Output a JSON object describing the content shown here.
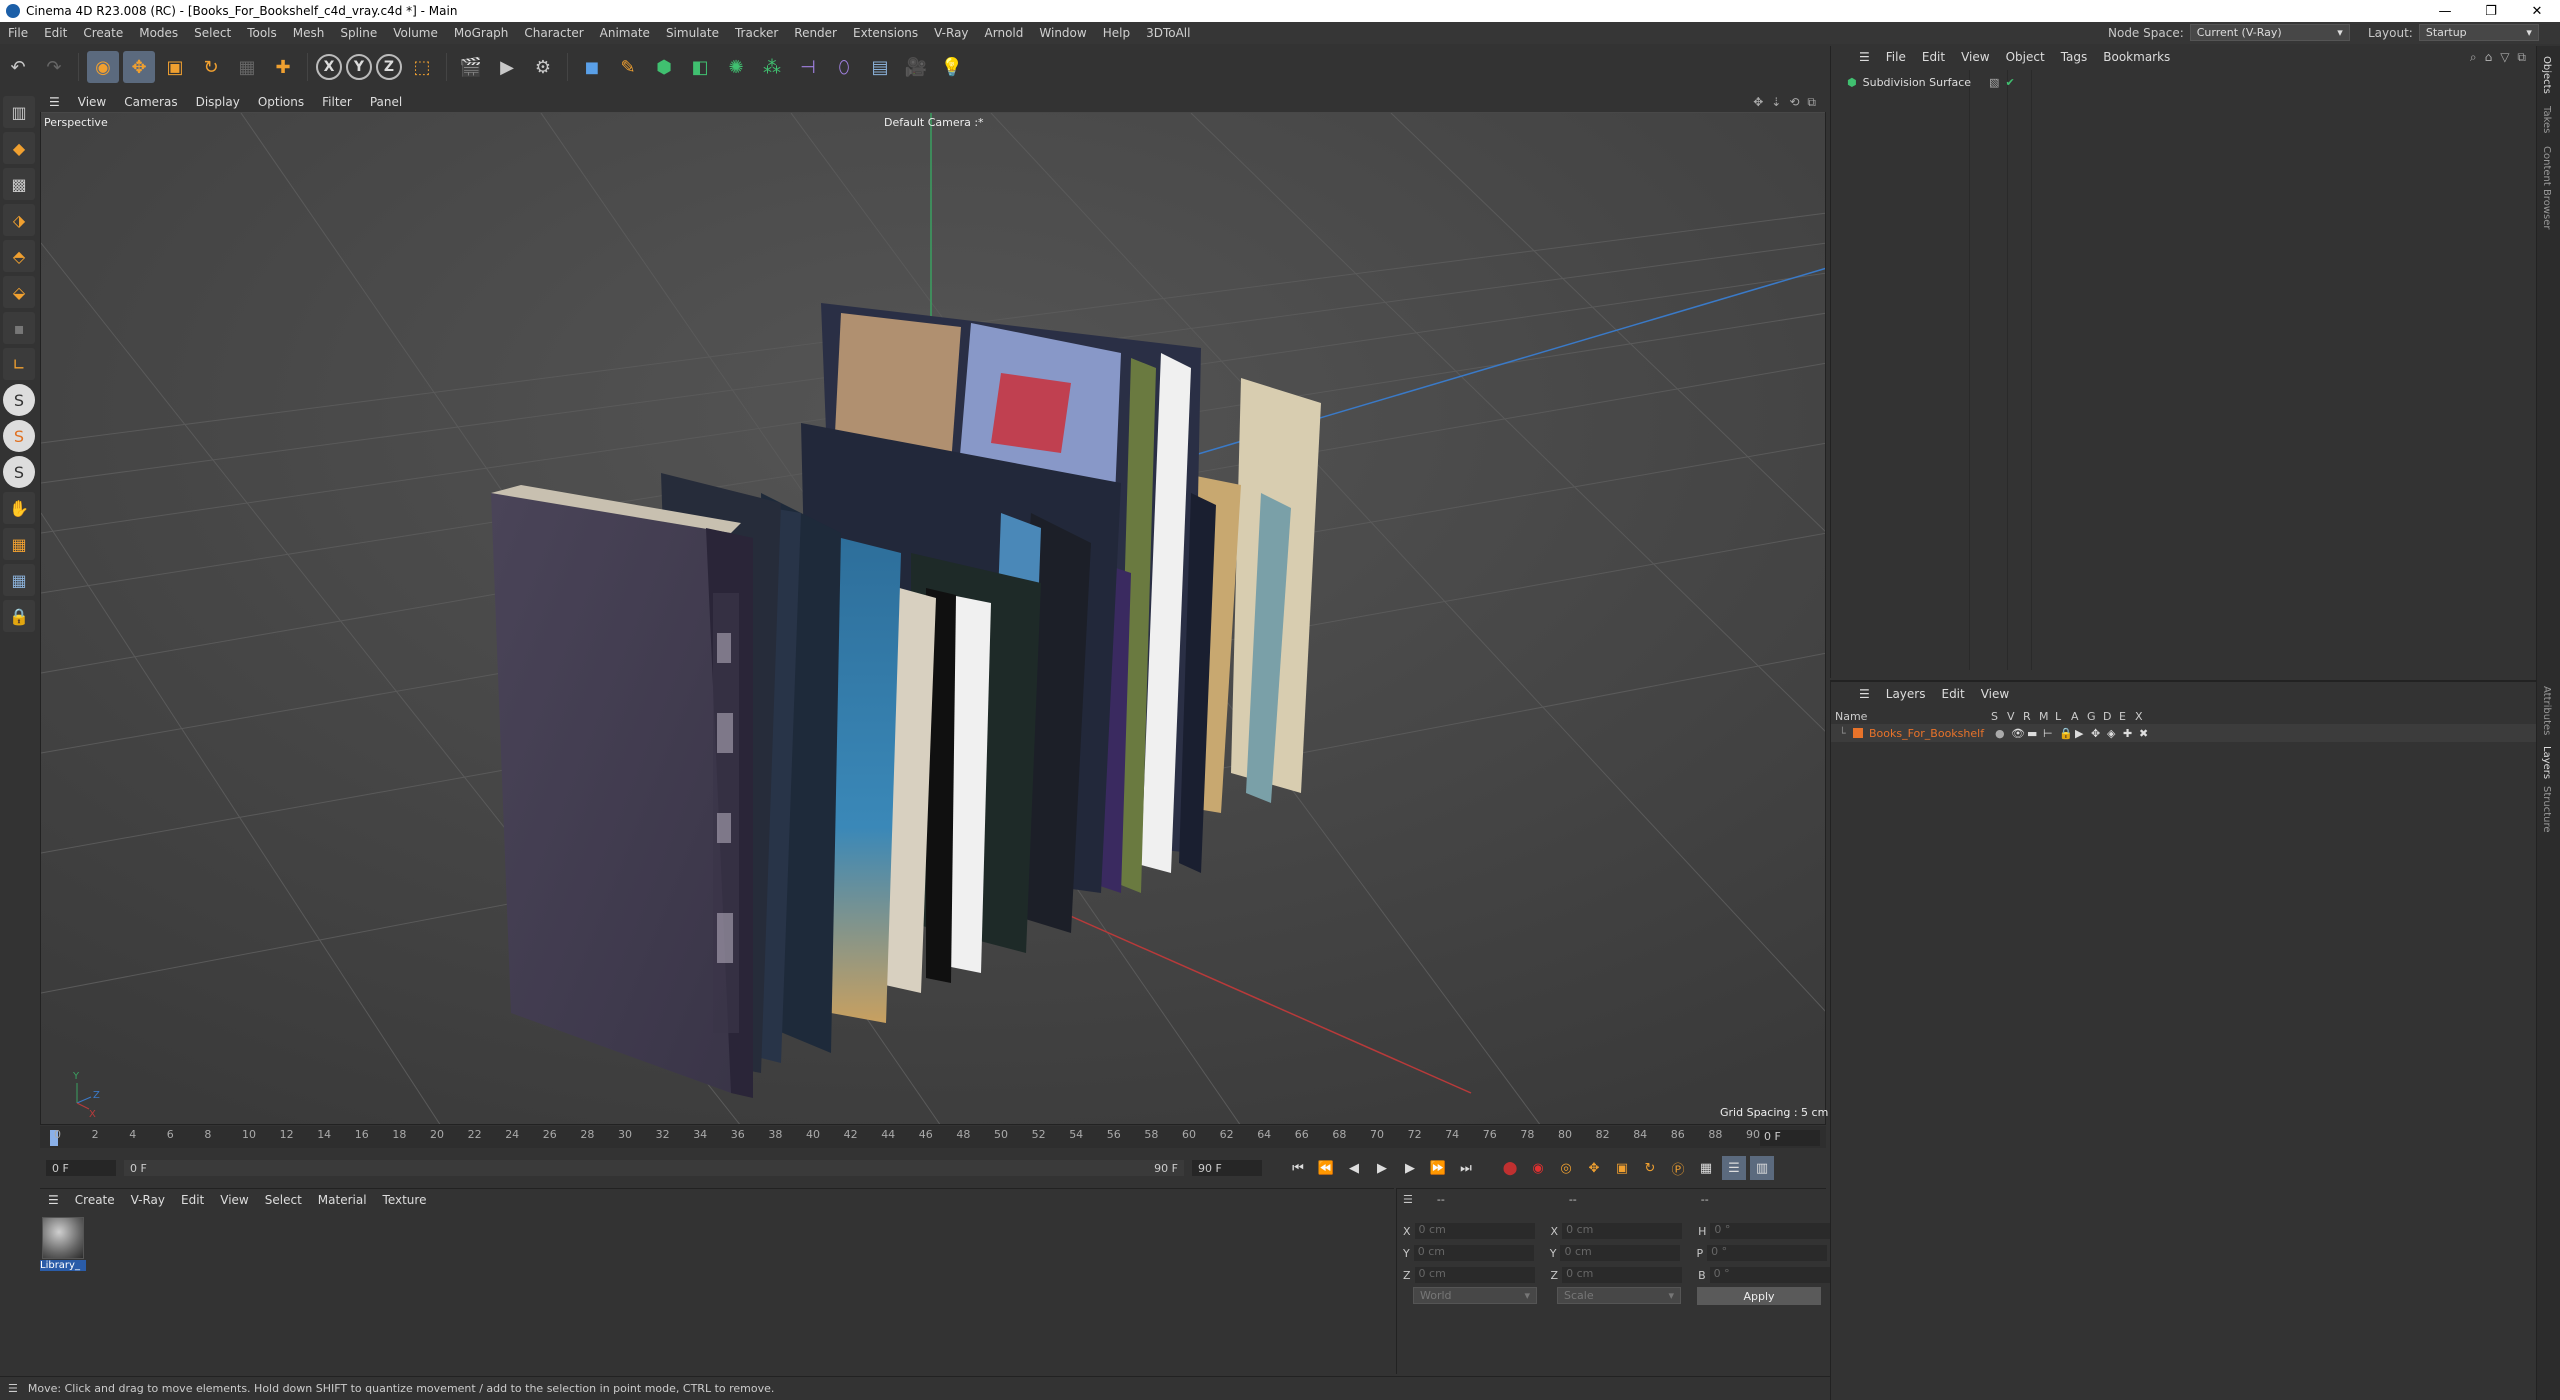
{
  "window": {
    "title": "Cinema 4D R23.008 (RC) - [Books_For_Bookshelf_c4d_vray.c4d *] - Main",
    "controls": [
      "—",
      "❐",
      "✕"
    ]
  },
  "menubar": {
    "items": [
      "File",
      "Edit",
      "Create",
      "Modes",
      "Select",
      "Tools",
      "Mesh",
      "Spline",
      "Volume",
      "MoGraph",
      "Character",
      "Animate",
      "Simulate",
      "Tracker",
      "Render",
      "Extensions",
      "V-Ray",
      "Arnold",
      "Window",
      "Help",
      "3DToAll"
    ],
    "node_space_label": "Node Space:",
    "node_space_value": "Current (V-Ray)",
    "layout_label": "Layout:",
    "layout_value": "Startup"
  },
  "toolbar": {
    "icons": [
      "undo-icon",
      "redo-icon",
      "live-selection-icon",
      "move-icon",
      "scale-icon",
      "rotate-icon",
      "recent-tools-icon",
      "add-icon",
      "x-axis-icon",
      "y-axis-icon",
      "z-axis-icon",
      "coordinate-system-icon",
      "render-region-icon",
      "render-view-icon",
      "render-settings-icon",
      "cube-icon",
      "pen-icon",
      "subdivision-icon",
      "extrude-icon",
      "cloner-icon",
      "array-icon",
      "symmetry-icon",
      "deformer-icon",
      "floor-icon",
      "camera-icon",
      "light-icon"
    ],
    "axis_labels": [
      "X",
      "Y",
      "Z"
    ]
  },
  "viewport": {
    "menu": [
      "View",
      "Cameras",
      "Display",
      "Options",
      "Filter",
      "Panel"
    ],
    "view_name": "Perspective",
    "camera_name": "Default Camera :*",
    "grid_spacing": "Grid Spacing : 5 cm",
    "axis_letters": [
      "Y",
      "Z",
      "X"
    ]
  },
  "timeline": {
    "ticks": [
      "0",
      "2",
      "4",
      "6",
      "8",
      "10",
      "12",
      "14",
      "16",
      "18",
      "20",
      "22",
      "24",
      "26",
      "28",
      "30",
      "32",
      "34",
      "36",
      "38",
      "40",
      "42",
      "44",
      "46",
      "48",
      "50",
      "52",
      "54",
      "56",
      "58",
      "60",
      "62",
      "64",
      "66",
      "68",
      "70",
      "72",
      "74",
      "76",
      "78",
      "80",
      "82",
      "84",
      "86",
      "88",
      "90"
    ],
    "current_frame_box": "0 F",
    "start_frame": "0 F",
    "range_start": "0 F",
    "range_end": "90 F",
    "end_frame": "90 F"
  },
  "materials": {
    "menu": [
      "Create",
      "V-Ray",
      "Edit",
      "View",
      "Select",
      "Material",
      "Texture"
    ],
    "items": [
      {
        "name": "Library_"
      }
    ]
  },
  "coordinates": {
    "header": [
      "--",
      "--",
      "--"
    ],
    "rows": [
      {
        "a": "X",
        "a_val": "0 cm",
        "b": "X",
        "b_val": "0 cm",
        "c": "H",
        "c_val": "0 °"
      },
      {
        "a": "Y",
        "a_val": "0 cm",
        "b": "Y",
        "b_val": "0 cm",
        "c": "P",
        "c_val": "0 °"
      },
      {
        "a": "Z",
        "a_val": "0 cm",
        "b": "Z",
        "b_val": "0 cm",
        "c": "B",
        "c_val": "0 °"
      }
    ],
    "space": "World",
    "mode": "Scale",
    "apply": "Apply"
  },
  "objects": {
    "menu": [
      "File",
      "Edit",
      "View",
      "Object",
      "Tags",
      "Bookmarks"
    ],
    "items": [
      {
        "name": "Subdivision Surface"
      }
    ]
  },
  "layers": {
    "menu": [
      "Layers",
      "Edit",
      "View"
    ],
    "columns": [
      "Name",
      "S",
      "V",
      "R",
      "M",
      "L",
      "A",
      "G",
      "D",
      "E",
      "X"
    ],
    "items": [
      {
        "name": "Books_For_Bookshelf",
        "color": "#e8732a"
      }
    ]
  },
  "right_tabs": [
    "Objects",
    "Takes",
    "Content Browser",
    "Attributes",
    "Layers",
    "Structure"
  ],
  "status": "Move: Click and drag to move elements. Hold down SHIFT to quantize movement / add to the selection in point mode, CTRL to remove.",
  "colors": {
    "accent": "#5b6a7e",
    "selection": "#2a5ca8",
    "layer_orange": "#e8732a"
  }
}
